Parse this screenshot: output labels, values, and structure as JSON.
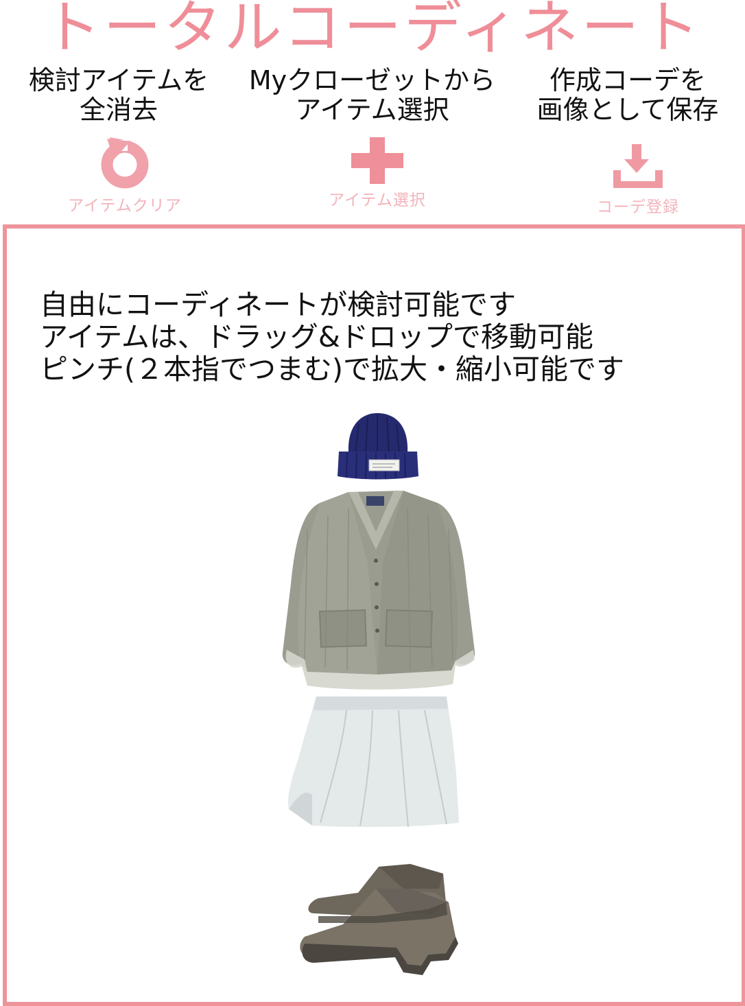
{
  "header": {
    "title": "トータルコーディネート"
  },
  "help": {
    "clear": [
      "検討アイテムを",
      "全消去"
    ],
    "select": [
      "Myクローゼットから",
      "アイテム選択"
    ],
    "save": [
      "作成コーデを",
      "画像として保存"
    ]
  },
  "actions": {
    "clear_label": "アイテムクリア",
    "select_label": "アイテム選択",
    "save_label": "コーデ登録"
  },
  "canvas": {
    "instructions": [
      "自由にコーディネートが検討可能です",
      "アイテムは、ドラッグ&ドロップで移動可能",
      "ピンチ(２本指でつまむ)で拡大・縮小可能です"
    ]
  },
  "colors": {
    "accent": "#ef8e98",
    "border": "#ee949b",
    "label": "#f2b3ba"
  },
  "icons": {
    "clear": "refresh-icon",
    "select": "plus-icon",
    "save": "download-icon"
  },
  "items": [
    "knit-beanie",
    "cardigan",
    "skirt",
    "ankle-boots"
  ]
}
